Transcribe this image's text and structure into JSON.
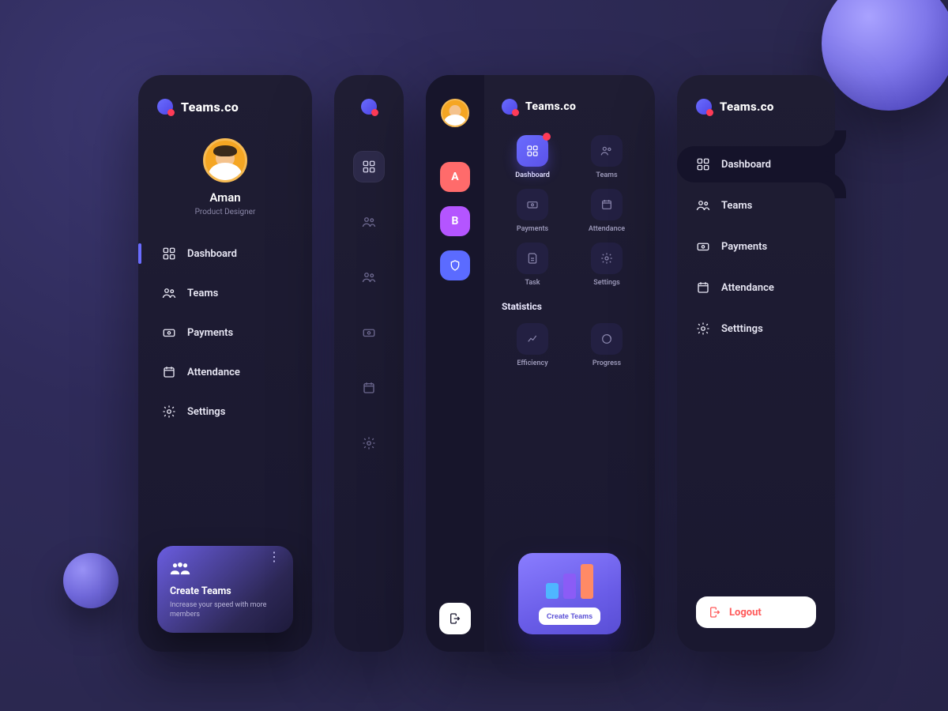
{
  "brand": {
    "name": "Teams.co"
  },
  "panel1": {
    "user": {
      "name": "Aman",
      "role": "Product Designer"
    },
    "nav": [
      {
        "label": "Dashboard"
      },
      {
        "label": "Teams"
      },
      {
        "label": "Payments"
      },
      {
        "label": "Attendance"
      },
      {
        "label": "Settings"
      }
    ],
    "cta": {
      "title": "Create  Teams",
      "subtitle": "Increase your speed with more members"
    }
  },
  "panel3": {
    "tabs": [
      {
        "letter": "A"
      },
      {
        "letter": "B"
      },
      {
        "letter": ""
      }
    ],
    "tiles": [
      {
        "label": "Dashboard"
      },
      {
        "label": "Teams"
      },
      {
        "label": "Payments"
      },
      {
        "label": "Attendance"
      },
      {
        "label": "Task"
      },
      {
        "label": "Settings"
      }
    ],
    "section": "Statistics",
    "stats": [
      {
        "label": "Efficiency"
      },
      {
        "label": "Progress"
      }
    ],
    "cta_button": "Create  Teams"
  },
  "panel4": {
    "nav": [
      {
        "label": "Dashboard"
      },
      {
        "label": "Teams"
      },
      {
        "label": "Payments"
      },
      {
        "label": "Attendance"
      },
      {
        "label": "Setttings"
      }
    ],
    "logout": "Logout"
  }
}
